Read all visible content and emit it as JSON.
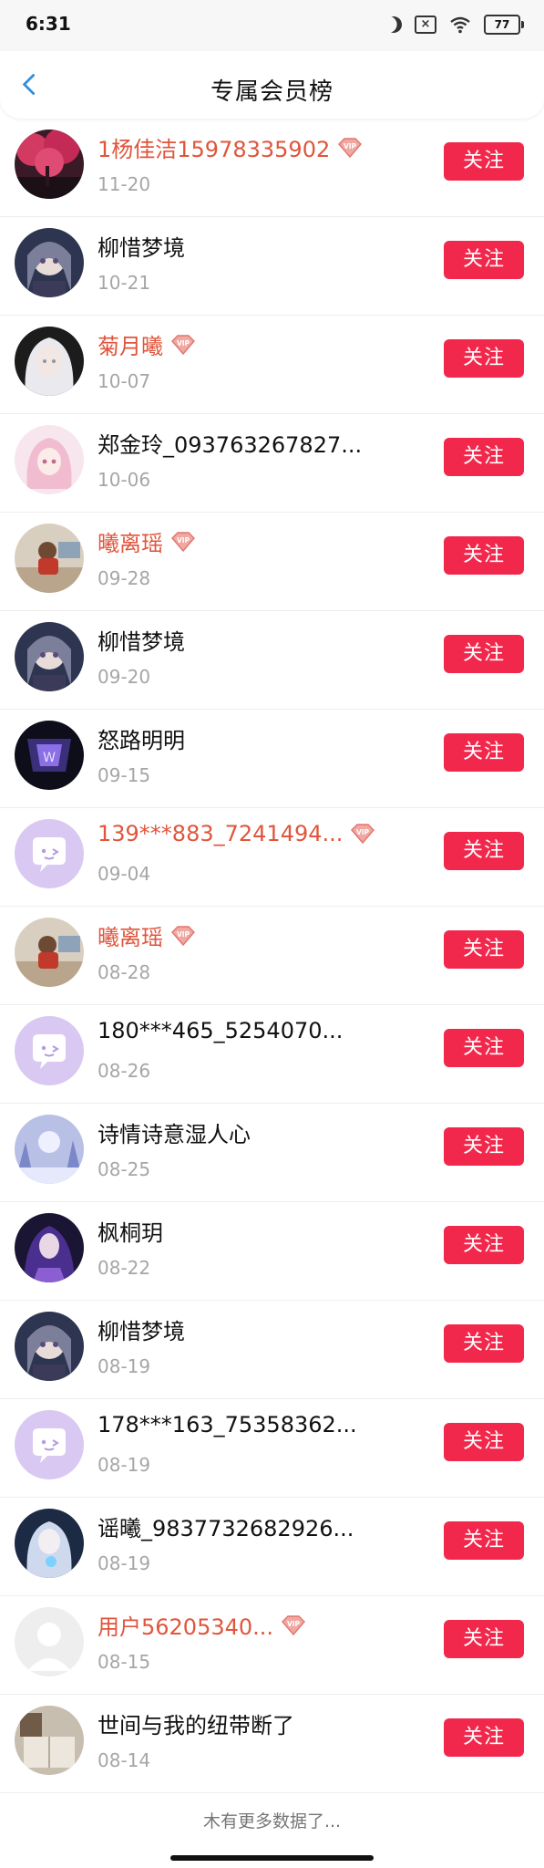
{
  "status_bar": {
    "time": "6:31",
    "battery": "77",
    "icons": [
      "moon-icon",
      "notification-off-icon",
      "wifi-icon",
      "battery-icon"
    ]
  },
  "header": {
    "title": "专属会员榜",
    "back_icon": "chevron-left-icon",
    "accent": "#2f8fe0"
  },
  "colors": {
    "vip_name": "#e0553c",
    "follow_button": "#f2274c",
    "date": "#a6a6a6"
  },
  "list": {
    "follow_label": "关注",
    "items": [
      {
        "name": "1杨佳洁15978335902",
        "date": "11-20",
        "vip": true,
        "avatar": "pink-trees"
      },
      {
        "name": "柳惜梦境",
        "date": "10-21",
        "vip": false,
        "avatar": "anime-girl-dark"
      },
      {
        "name": "菊月曦",
        "date": "10-07",
        "vip": true,
        "avatar": "white-hair-girl"
      },
      {
        "name": "郑金玲_093763267827...",
        "date": "10-06",
        "vip": false,
        "avatar": "pink-anime-girl"
      },
      {
        "name": "曦离瑶",
        "date": "09-28",
        "vip": true,
        "avatar": "child-photo"
      },
      {
        "name": "柳惜梦境",
        "date": "09-20",
        "vip": false,
        "avatar": "anime-girl-dark"
      },
      {
        "name": "怒路明明",
        "date": "09-15",
        "vip": false,
        "avatar": "purple-dark-art"
      },
      {
        "name": "139***883_7241494...",
        "date": "09-04",
        "vip": true,
        "avatar": "purple-chat-bubble"
      },
      {
        "name": "曦离瑶",
        "date": "08-28",
        "vip": true,
        "avatar": "child-photo"
      },
      {
        "name": "180***465_5254070...",
        "date": "08-26",
        "vip": false,
        "avatar": "purple-chat-bubble"
      },
      {
        "name": "诗情诗意湿人心",
        "date": "08-25",
        "vip": false,
        "avatar": "snow-forest"
      },
      {
        "name": "枫桐玥",
        "date": "08-22",
        "vip": false,
        "avatar": "purple-warrior"
      },
      {
        "name": "柳惜梦境",
        "date": "08-19",
        "vip": false,
        "avatar": "anime-girl-dark"
      },
      {
        "name": "178***163_75358362...",
        "date": "08-19",
        "vip": false,
        "avatar": "purple-chat-bubble"
      },
      {
        "name": "谣曦_9837732682926...",
        "date": "08-19",
        "vip": false,
        "avatar": "blue-glow-girl"
      },
      {
        "name": "用户56205340...",
        "date": "08-15",
        "vip": true,
        "avatar": "default-person"
      },
      {
        "name": "世间与我的纽带断了",
        "date": "08-14",
        "vip": false,
        "avatar": "book-photo"
      }
    ]
  },
  "footer": {
    "text": "木有更多数据了..."
  }
}
